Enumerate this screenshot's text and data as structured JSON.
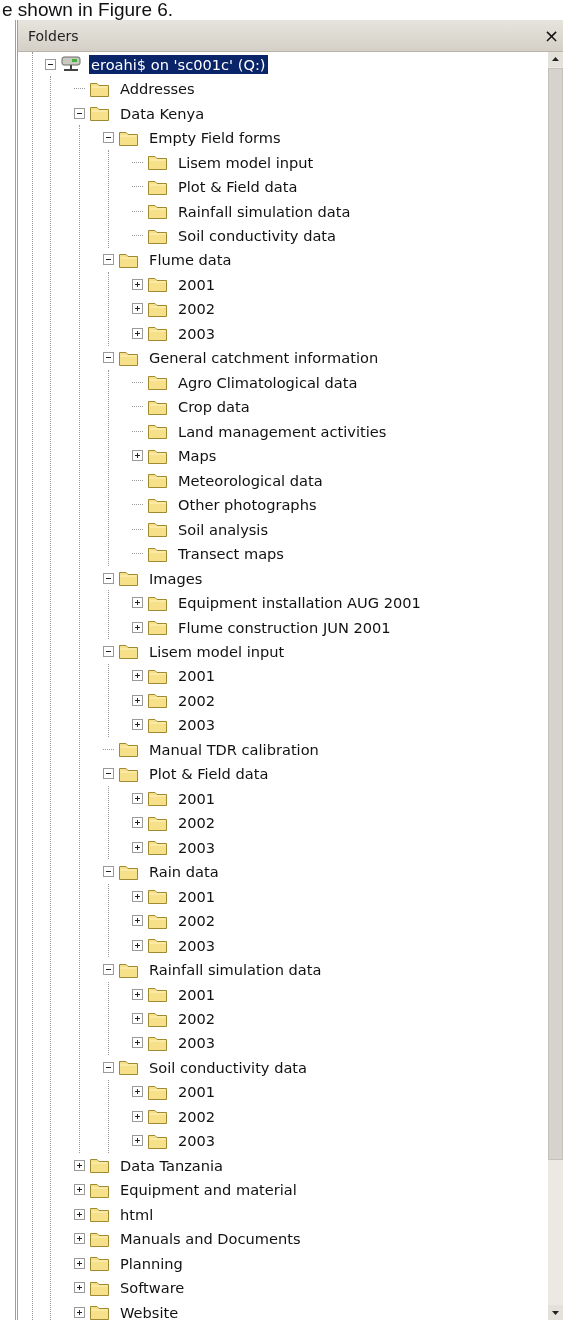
{
  "caption": "e shown in Figure 6.",
  "panel": {
    "title": "Folders",
    "close": "×"
  },
  "tree": [
    {
      "kind": "drive",
      "label": "eroahi$ on 'sc001c' (Q:)",
      "expanded": true,
      "selected": true,
      "children": [
        {
          "kind": "folder",
          "label": "Addresses",
          "selected": false
        },
        {
          "kind": "folder",
          "label": "Data Kenya",
          "expanded": true,
          "selected": false,
          "children": [
            {
              "kind": "folder",
              "label": "Empty Field forms",
              "expanded": true,
              "selected": false,
              "children": [
                {
                  "kind": "folder",
                  "label": "Lisem model input",
                  "selected": false
                },
                {
                  "kind": "folder",
                  "label": "Plot & Field data",
                  "selected": false
                },
                {
                  "kind": "folder",
                  "label": "Rainfall simulation data",
                  "selected": false
                },
                {
                  "kind": "folder",
                  "label": "Soil conductivity data",
                  "selected": false
                }
              ]
            },
            {
              "kind": "folder",
              "label": "Flume data",
              "expanded": true,
              "selected": false,
              "children": [
                {
                  "kind": "folder",
                  "label": "2001",
                  "expanded": false,
                  "selected": false
                },
                {
                  "kind": "folder",
                  "label": "2002",
                  "expanded": false,
                  "selected": false
                },
                {
                  "kind": "folder",
                  "label": "2003",
                  "expanded": false,
                  "selected": false
                }
              ]
            },
            {
              "kind": "folder",
              "label": "General catchment information",
              "expanded": true,
              "selected": false,
              "children": [
                {
                  "kind": "folder",
                  "label": "Agro Climatological data",
                  "selected": false
                },
                {
                  "kind": "folder",
                  "label": "Crop data",
                  "selected": false
                },
                {
                  "kind": "folder",
                  "label": "Land management activities",
                  "selected": false
                },
                {
                  "kind": "folder",
                  "label": "Maps",
                  "expanded": false,
                  "selected": false
                },
                {
                  "kind": "folder",
                  "label": "Meteorological data",
                  "selected": false
                },
                {
                  "kind": "folder",
                  "label": "Other photographs",
                  "selected": false
                },
                {
                  "kind": "folder",
                  "label": "Soil analysis",
                  "selected": false
                },
                {
                  "kind": "folder",
                  "label": "Transect maps",
                  "selected": false
                }
              ]
            },
            {
              "kind": "folder",
              "label": "Images",
              "expanded": true,
              "selected": false,
              "children": [
                {
                  "kind": "folder",
                  "label": "Equipment installation AUG 2001",
                  "expanded": false,
                  "selected": false
                },
                {
                  "kind": "folder",
                  "label": "Flume construction JUN 2001",
                  "expanded": false,
                  "selected": false
                }
              ]
            },
            {
              "kind": "folder",
              "label": "Lisem model input",
              "expanded": true,
              "selected": false,
              "children": [
                {
                  "kind": "folder",
                  "label": "2001",
                  "expanded": false,
                  "selected": false
                },
                {
                  "kind": "folder",
                  "label": "2002",
                  "expanded": false,
                  "selected": false
                },
                {
                  "kind": "folder",
                  "label": "2003",
                  "expanded": false,
                  "selected": false
                }
              ]
            },
            {
              "kind": "folder",
              "label": "Manual TDR calibration",
              "selected": false
            },
            {
              "kind": "folder",
              "label": "Plot & Field data",
              "expanded": true,
              "selected": false,
              "children": [
                {
                  "kind": "folder",
                  "label": "2001",
                  "expanded": false,
                  "selected": false
                },
                {
                  "kind": "folder",
                  "label": "2002",
                  "expanded": false,
                  "selected": false
                },
                {
                  "kind": "folder",
                  "label": "2003",
                  "expanded": false,
                  "selected": false
                }
              ]
            },
            {
              "kind": "folder",
              "label": "Rain data",
              "expanded": true,
              "selected": false,
              "children": [
                {
                  "kind": "folder",
                  "label": "2001",
                  "expanded": false,
                  "selected": false
                },
                {
                  "kind": "folder",
                  "label": "2002",
                  "expanded": false,
                  "selected": false
                },
                {
                  "kind": "folder",
                  "label": "2003",
                  "expanded": false,
                  "selected": false
                }
              ]
            },
            {
              "kind": "folder",
              "label": "Rainfall simulation data",
              "expanded": true,
              "selected": false,
              "children": [
                {
                  "kind": "folder",
                  "label": "2001",
                  "expanded": false,
                  "selected": false
                },
                {
                  "kind": "folder",
                  "label": "2002",
                  "expanded": false,
                  "selected": false
                },
                {
                  "kind": "folder",
                  "label": "2003",
                  "expanded": false,
                  "selected": false
                }
              ]
            },
            {
              "kind": "folder",
              "label": "Soil conductivity data",
              "expanded": true,
              "selected": false,
              "children": [
                {
                  "kind": "folder",
                  "label": "2001",
                  "expanded": false,
                  "selected": false
                },
                {
                  "kind": "folder",
                  "label": "2002",
                  "expanded": false,
                  "selected": false
                },
                {
                  "kind": "folder",
                  "label": "2003",
                  "expanded": false,
                  "selected": false
                }
              ]
            }
          ]
        },
        {
          "kind": "folder",
          "label": "Data Tanzania",
          "expanded": false,
          "selected": false
        },
        {
          "kind": "folder",
          "label": "Equipment and material",
          "expanded": false,
          "selected": false
        },
        {
          "kind": "folder",
          "label": "html",
          "expanded": false,
          "selected": false
        },
        {
          "kind": "folder",
          "label": "Manuals and Documents",
          "expanded": false,
          "selected": false
        },
        {
          "kind": "folder",
          "label": "Planning",
          "expanded": false,
          "selected": false
        },
        {
          "kind": "folder",
          "label": "Software",
          "expanded": false,
          "selected": false
        },
        {
          "kind": "folder",
          "label": "Website",
          "expanded": false,
          "selected": false
        }
      ]
    }
  ]
}
